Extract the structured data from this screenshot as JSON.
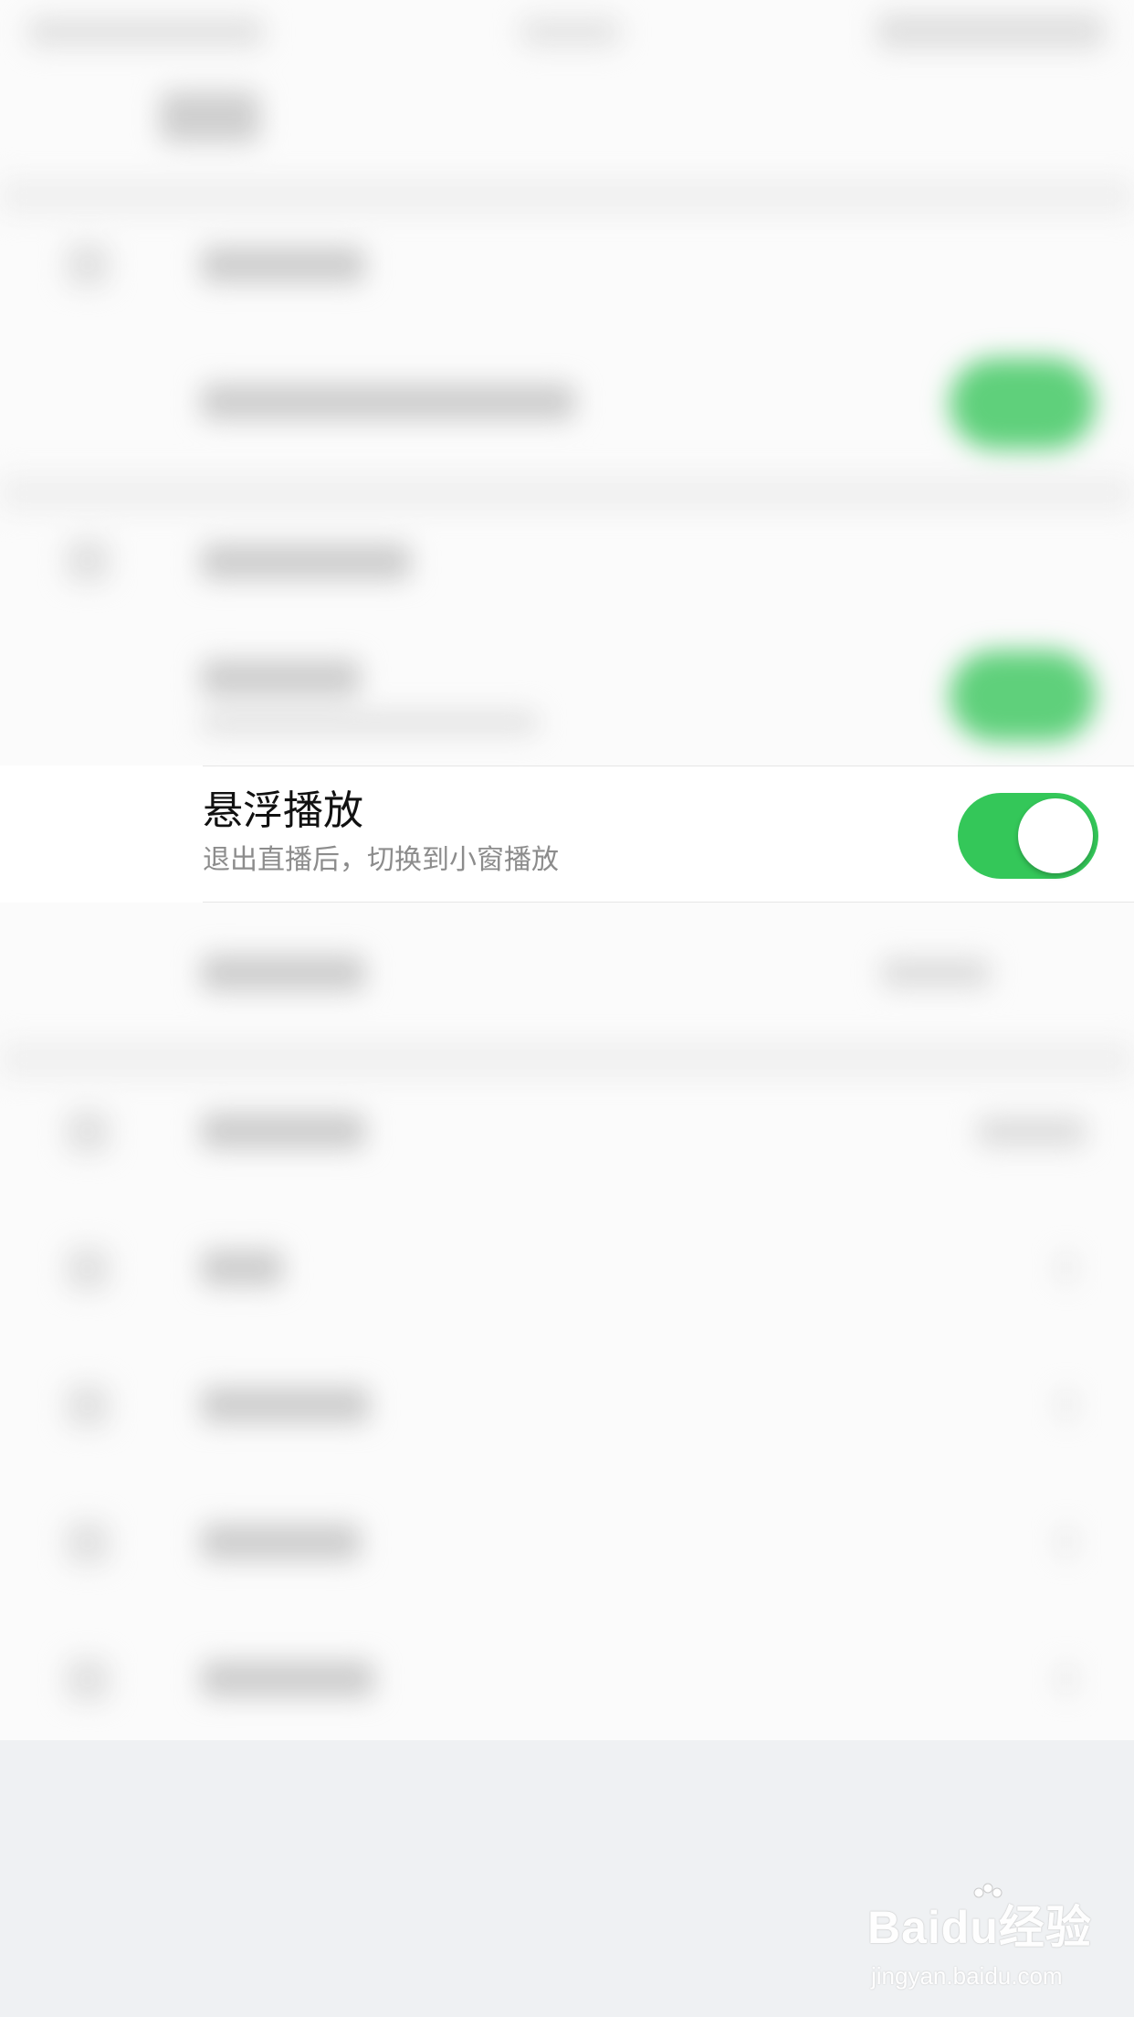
{
  "setting_row": {
    "title": "悬浮播放",
    "subtitle": "退出直播后，切换到小窗播放",
    "toggle_on": true
  },
  "colors": {
    "toggle_on": "#34c759",
    "title": "#111111",
    "subtitle": "#8c8c8c",
    "background": "#fbfbfb"
  },
  "watermark": {
    "logo": "Baidu经验",
    "url": "jingyan.baidu.com"
  },
  "icons": [
    "paw-icon"
  ]
}
